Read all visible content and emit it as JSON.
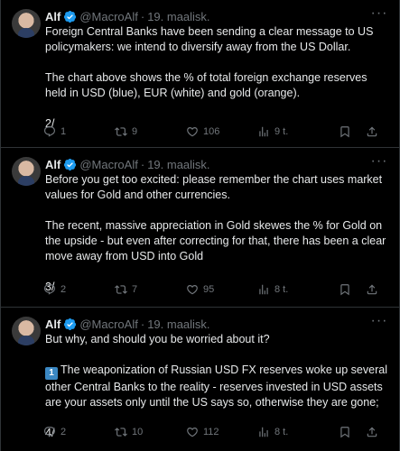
{
  "tweets": [
    {
      "name": "Alf",
      "handle": "@MacroAlf",
      "separator": "·",
      "date": "19. maalisk.",
      "paragraphs": [
        "Foreign Central Banks have been sending a clear message to US policymakers: we intend to diversify away from the US Dollar.",
        "The chart above shows the % of total foreign exchange reserves held in USD (blue), EUR (white) and gold (orange).",
        "2/"
      ],
      "replies": "1",
      "retweets": "9",
      "likes": "106",
      "views": "9 t."
    },
    {
      "name": "Alf",
      "handle": "@MacroAlf",
      "separator": "·",
      "date": "19. maalisk.",
      "paragraphs": [
        "Before you get too excited: please remember the chart uses market values for Gold and other currencies.",
        "The recent, massive appreciation in Gold skewes the % for Gold on the upside - but even after correcting for that, there has been a clear move away from USD into Gold",
        "3/"
      ],
      "replies": "2",
      "retweets": "7",
      "likes": "95",
      "views": "8 t."
    },
    {
      "name": "Alf",
      "handle": "@MacroAlf",
      "separator": "·",
      "date": "19. maalisk.",
      "paragraphs": [
        "But why, and should you be worried about it?",
        "The weaponization of Russian USD FX reserves woke up several other Central Banks to the reality - reserves invested in USD assets are your assets only until the US says so, otherwise they are gone;",
        "4/"
      ],
      "emoji_keycap": "1",
      "replies": "2",
      "retweets": "10",
      "likes": "112",
      "views": "8 t."
    }
  ],
  "colors": {
    "background": "#000000",
    "text": "#e7e9ea",
    "muted": "#71767b",
    "verified": "#1d9bf0",
    "divider": "#2f3336"
  },
  "icons": [
    "more-icon",
    "verified-badge-icon",
    "reply-icon",
    "retweet-icon",
    "like-icon",
    "views-icon",
    "bookmark-icon",
    "share-icon"
  ]
}
